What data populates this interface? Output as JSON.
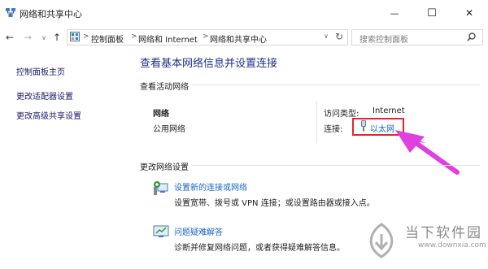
{
  "window": {
    "title": "网络和共享中心",
    "controls": {
      "minimize": "—",
      "maximize": "☐",
      "close": "✕"
    }
  },
  "nav": {
    "back": "←",
    "forward": "→",
    "dropdown": "∨",
    "up": "↑",
    "breadcrumb": [
      "控制面板",
      "网络和 Internet",
      "网络和共享中心"
    ],
    "separator": ">",
    "breadcrumb_dropdown": "∨",
    "refresh": "↻",
    "search_placeholder": "搜索控制面板"
  },
  "sidebar": {
    "items": [
      {
        "label": "控制面板主页"
      },
      {
        "label": "更改适配器设置"
      },
      {
        "label": "更改高级共享设置"
      }
    ]
  },
  "main": {
    "title": "查看基本网络信息并设置连接",
    "active_networks_label": "查看活动网络",
    "network": {
      "name": "网络",
      "type": "公用网络",
      "access_type_label": "访问类型:",
      "access_type_value": "Internet",
      "connection_label": "连接:",
      "connection_value": "以太网"
    },
    "change_settings_label": "更改网络设置",
    "tasks": [
      {
        "title": "设置新的连接或网络",
        "desc": "设置宽带、拨号或 VPN 连接；或设置路由器或接入点。"
      },
      {
        "title": "问题疑难解答",
        "desc": "诊断并修复网络问题，或者获得疑难解答信息。"
      }
    ]
  },
  "annotation": {
    "highlight_color": "#e3262b",
    "arrow_color": "#e040e0"
  },
  "watermark": {
    "text": "当下软件园",
    "url": "www.downxia.com"
  }
}
